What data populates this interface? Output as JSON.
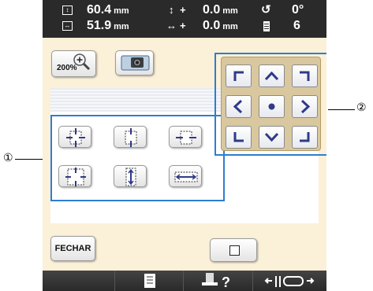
{
  "status": {
    "height_value": "60.4",
    "width_value": "51.9",
    "unit": "mm",
    "offset_y_sign": "+",
    "offset_y_value": "0.0",
    "offset_x_sign": "+",
    "offset_x_value": "0.0",
    "rotation_value": "0°",
    "color_count": "6"
  },
  "toolbar": {
    "zoom_label": "200%"
  },
  "callouts": {
    "left": "①",
    "right": "②"
  },
  "buttons": {
    "close_label": "FECHAR"
  },
  "colors": {
    "accent": "#2e7dd1",
    "panel_bg": "#fbf0d8",
    "statusbar": "#2a2a2a",
    "arrow_blue": "#2f3a8a"
  }
}
